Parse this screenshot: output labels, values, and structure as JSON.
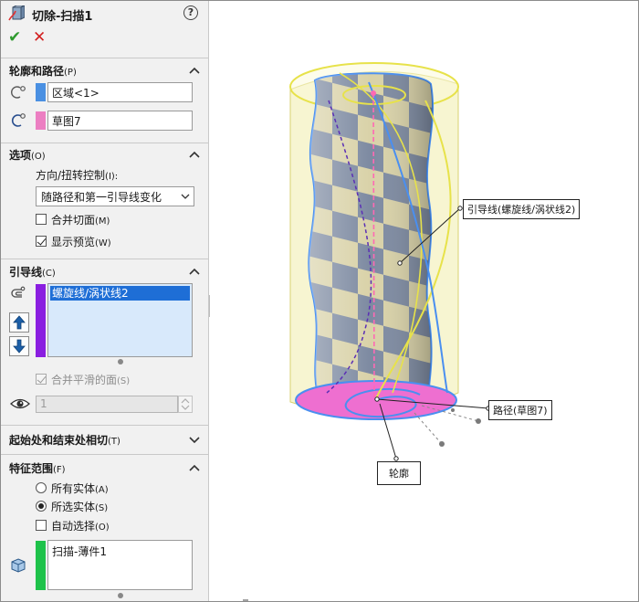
{
  "header": {
    "title": "切除-扫描1",
    "help_glyph": "?",
    "ok_glyph": "✔",
    "cancel_glyph": "✕"
  },
  "profile_path": {
    "title": "轮廓和路径",
    "key": "(P)",
    "profile_value": "区域<1>",
    "path_value": "草图7",
    "profile_color": "#4a90e2",
    "path_color": "#ec7fc2"
  },
  "options": {
    "title": "选项",
    "key": "(O)",
    "orientation_label": "方向/扭转控制",
    "orientation_key": "(I):",
    "orientation_selected": "随路径和第一引导线变化",
    "merge_tangent_label": "合并切面",
    "merge_tangent_key": "(M)",
    "merge_tangent_checked": false,
    "show_preview_label": "显示预览",
    "show_preview_key": "(W)",
    "show_preview_checked": true
  },
  "guide_curves": {
    "title": "引导线",
    "key": "(C)",
    "items": [
      "螺旋线/涡状线2"
    ],
    "list_color": "#8a1ee0",
    "merge_smooth_label": "合并平滑的面",
    "merge_smooth_key": "(S)",
    "merge_smooth_checked": true,
    "section_count": "1",
    "up_glyph": "⇧",
    "down_glyph": "⇩"
  },
  "tangency": {
    "title": "起始处和结束处相切",
    "key": "(T)"
  },
  "feature_scope": {
    "title": "特征范围",
    "key": "(F)",
    "all_bodies_label": "所有实体",
    "all_bodies_key": "(A)",
    "selected_bodies_label": "所选实体",
    "selected_bodies_key": "(S)",
    "auto_select_label": "自动选择",
    "auto_select_key": "(O)",
    "bodies": [
      "扫描-薄件1"
    ],
    "list_color": "#1ec24a",
    "selected_option": "selected_bodies",
    "auto_select_checked": false
  },
  "viewport": {
    "callout_guide": "引导线(螺旋线/涡状线2)",
    "callout_path": "路径(草图7)",
    "callout_profile": "轮廓",
    "preview_color": "#f5f0a0",
    "edge_color": "#4a8ff0",
    "path_line_color": "#ff69b4"
  }
}
